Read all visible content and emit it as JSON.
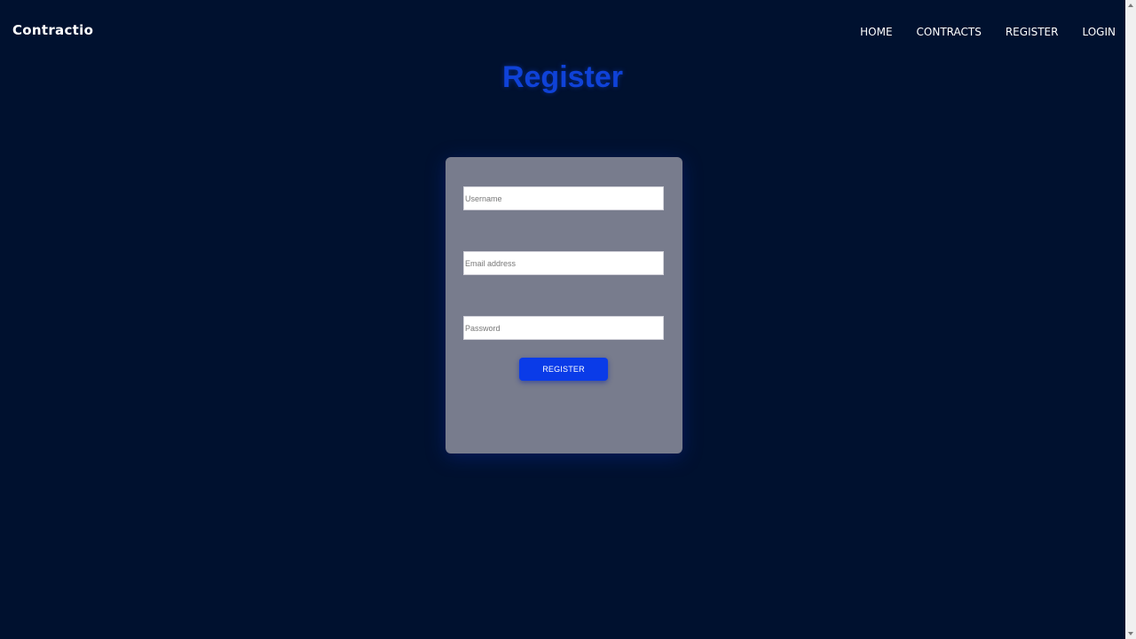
{
  "header": {
    "brand": "Contractio",
    "nav": [
      "HOME",
      "CONTRACTS",
      "REGISTER",
      "LOGIN"
    ]
  },
  "main": {
    "title": "Register",
    "form": {
      "username_placeholder": "Username",
      "email_placeholder": "Email address",
      "password_placeholder": "Password",
      "submit_label": "REGISTER"
    }
  },
  "colors": {
    "background": "#00112f",
    "card": "#787c8d",
    "accent": "#0a3be8",
    "title": "#0f42d8"
  }
}
